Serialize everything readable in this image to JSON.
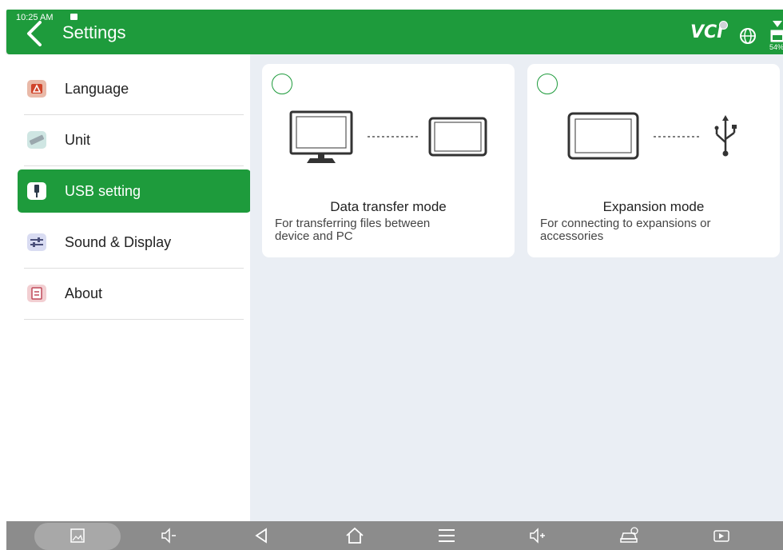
{
  "status": {
    "time": "10:25 AM",
    "battery": "54%"
  },
  "header": {
    "title": "Settings",
    "vci_label": "VCI"
  },
  "sidebar": {
    "items": [
      {
        "label": "Language"
      },
      {
        "label": "Unit"
      },
      {
        "label": "USB setting"
      },
      {
        "label": "Sound & Display"
      },
      {
        "label": "About"
      }
    ],
    "active_index": 2
  },
  "usb_modes": [
    {
      "title": "Data transfer mode",
      "description_line1": "For transferring files between",
      "description_line2": "device and PC"
    },
    {
      "title": "Expansion mode",
      "description_line1": "For connecting to expansions or",
      "description_line2": "accessories"
    }
  ],
  "colors": {
    "accent": "#1e9b3c",
    "main_bg": "#eaeef4",
    "navbar": "#8c8c8c"
  },
  "icons": [
    "back-icon",
    "vci-icon",
    "globe-icon",
    "battery-icon",
    "language-icon",
    "unit-icon",
    "usb-icon",
    "sound-display-icon",
    "about-icon",
    "monitor-icon",
    "tablet-icon",
    "usb-symbol-icon",
    "screenshot-icon",
    "volume-down-icon",
    "nav-back-icon",
    "home-icon",
    "menu-icon",
    "volume-up-icon",
    "car-diagnostic-icon",
    "screen-record-icon"
  ]
}
